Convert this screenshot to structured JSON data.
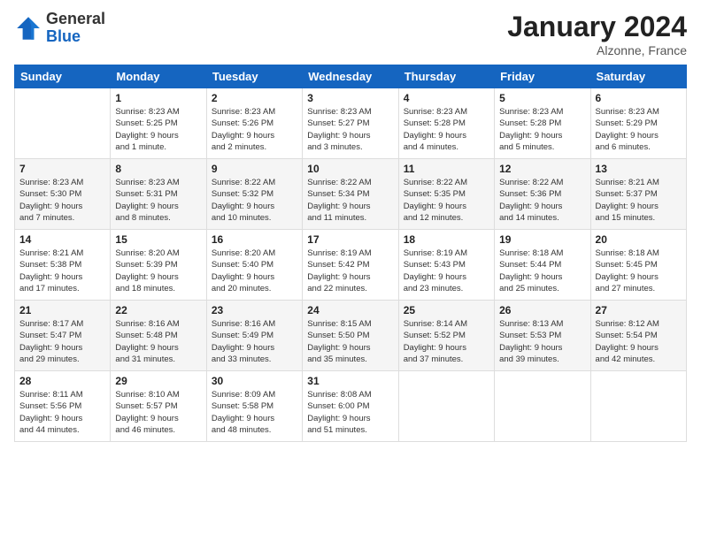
{
  "logo": {
    "general": "General",
    "blue": "Blue"
  },
  "title": "January 2024",
  "location": "Alzonne, France",
  "weekdays": [
    "Sunday",
    "Monday",
    "Tuesday",
    "Wednesday",
    "Thursday",
    "Friday",
    "Saturday"
  ],
  "weeks": [
    [
      {
        "day": "",
        "info": ""
      },
      {
        "day": "1",
        "info": "Sunrise: 8:23 AM\nSunset: 5:25 PM\nDaylight: 9 hours\nand 1 minute."
      },
      {
        "day": "2",
        "info": "Sunrise: 8:23 AM\nSunset: 5:26 PM\nDaylight: 9 hours\nand 2 minutes."
      },
      {
        "day": "3",
        "info": "Sunrise: 8:23 AM\nSunset: 5:27 PM\nDaylight: 9 hours\nand 3 minutes."
      },
      {
        "day": "4",
        "info": "Sunrise: 8:23 AM\nSunset: 5:28 PM\nDaylight: 9 hours\nand 4 minutes."
      },
      {
        "day": "5",
        "info": "Sunrise: 8:23 AM\nSunset: 5:28 PM\nDaylight: 9 hours\nand 5 minutes."
      },
      {
        "day": "6",
        "info": "Sunrise: 8:23 AM\nSunset: 5:29 PM\nDaylight: 9 hours\nand 6 minutes."
      }
    ],
    [
      {
        "day": "7",
        "info": "Sunrise: 8:23 AM\nSunset: 5:30 PM\nDaylight: 9 hours\nand 7 minutes."
      },
      {
        "day": "8",
        "info": "Sunrise: 8:23 AM\nSunset: 5:31 PM\nDaylight: 9 hours\nand 8 minutes."
      },
      {
        "day": "9",
        "info": "Sunrise: 8:22 AM\nSunset: 5:32 PM\nDaylight: 9 hours\nand 10 minutes."
      },
      {
        "day": "10",
        "info": "Sunrise: 8:22 AM\nSunset: 5:34 PM\nDaylight: 9 hours\nand 11 minutes."
      },
      {
        "day": "11",
        "info": "Sunrise: 8:22 AM\nSunset: 5:35 PM\nDaylight: 9 hours\nand 12 minutes."
      },
      {
        "day": "12",
        "info": "Sunrise: 8:22 AM\nSunset: 5:36 PM\nDaylight: 9 hours\nand 14 minutes."
      },
      {
        "day": "13",
        "info": "Sunrise: 8:21 AM\nSunset: 5:37 PM\nDaylight: 9 hours\nand 15 minutes."
      }
    ],
    [
      {
        "day": "14",
        "info": "Sunrise: 8:21 AM\nSunset: 5:38 PM\nDaylight: 9 hours\nand 17 minutes."
      },
      {
        "day": "15",
        "info": "Sunrise: 8:20 AM\nSunset: 5:39 PM\nDaylight: 9 hours\nand 18 minutes."
      },
      {
        "day": "16",
        "info": "Sunrise: 8:20 AM\nSunset: 5:40 PM\nDaylight: 9 hours\nand 20 minutes."
      },
      {
        "day": "17",
        "info": "Sunrise: 8:19 AM\nSunset: 5:42 PM\nDaylight: 9 hours\nand 22 minutes."
      },
      {
        "day": "18",
        "info": "Sunrise: 8:19 AM\nSunset: 5:43 PM\nDaylight: 9 hours\nand 23 minutes."
      },
      {
        "day": "19",
        "info": "Sunrise: 8:18 AM\nSunset: 5:44 PM\nDaylight: 9 hours\nand 25 minutes."
      },
      {
        "day": "20",
        "info": "Sunrise: 8:18 AM\nSunset: 5:45 PM\nDaylight: 9 hours\nand 27 minutes."
      }
    ],
    [
      {
        "day": "21",
        "info": "Sunrise: 8:17 AM\nSunset: 5:47 PM\nDaylight: 9 hours\nand 29 minutes."
      },
      {
        "day": "22",
        "info": "Sunrise: 8:16 AM\nSunset: 5:48 PM\nDaylight: 9 hours\nand 31 minutes."
      },
      {
        "day": "23",
        "info": "Sunrise: 8:16 AM\nSunset: 5:49 PM\nDaylight: 9 hours\nand 33 minutes."
      },
      {
        "day": "24",
        "info": "Sunrise: 8:15 AM\nSunset: 5:50 PM\nDaylight: 9 hours\nand 35 minutes."
      },
      {
        "day": "25",
        "info": "Sunrise: 8:14 AM\nSunset: 5:52 PM\nDaylight: 9 hours\nand 37 minutes."
      },
      {
        "day": "26",
        "info": "Sunrise: 8:13 AM\nSunset: 5:53 PM\nDaylight: 9 hours\nand 39 minutes."
      },
      {
        "day": "27",
        "info": "Sunrise: 8:12 AM\nSunset: 5:54 PM\nDaylight: 9 hours\nand 42 minutes."
      }
    ],
    [
      {
        "day": "28",
        "info": "Sunrise: 8:11 AM\nSunset: 5:56 PM\nDaylight: 9 hours\nand 44 minutes."
      },
      {
        "day": "29",
        "info": "Sunrise: 8:10 AM\nSunset: 5:57 PM\nDaylight: 9 hours\nand 46 minutes."
      },
      {
        "day": "30",
        "info": "Sunrise: 8:09 AM\nSunset: 5:58 PM\nDaylight: 9 hours\nand 48 minutes."
      },
      {
        "day": "31",
        "info": "Sunrise: 8:08 AM\nSunset: 6:00 PM\nDaylight: 9 hours\nand 51 minutes."
      },
      {
        "day": "",
        "info": ""
      },
      {
        "day": "",
        "info": ""
      },
      {
        "day": "",
        "info": ""
      }
    ]
  ]
}
